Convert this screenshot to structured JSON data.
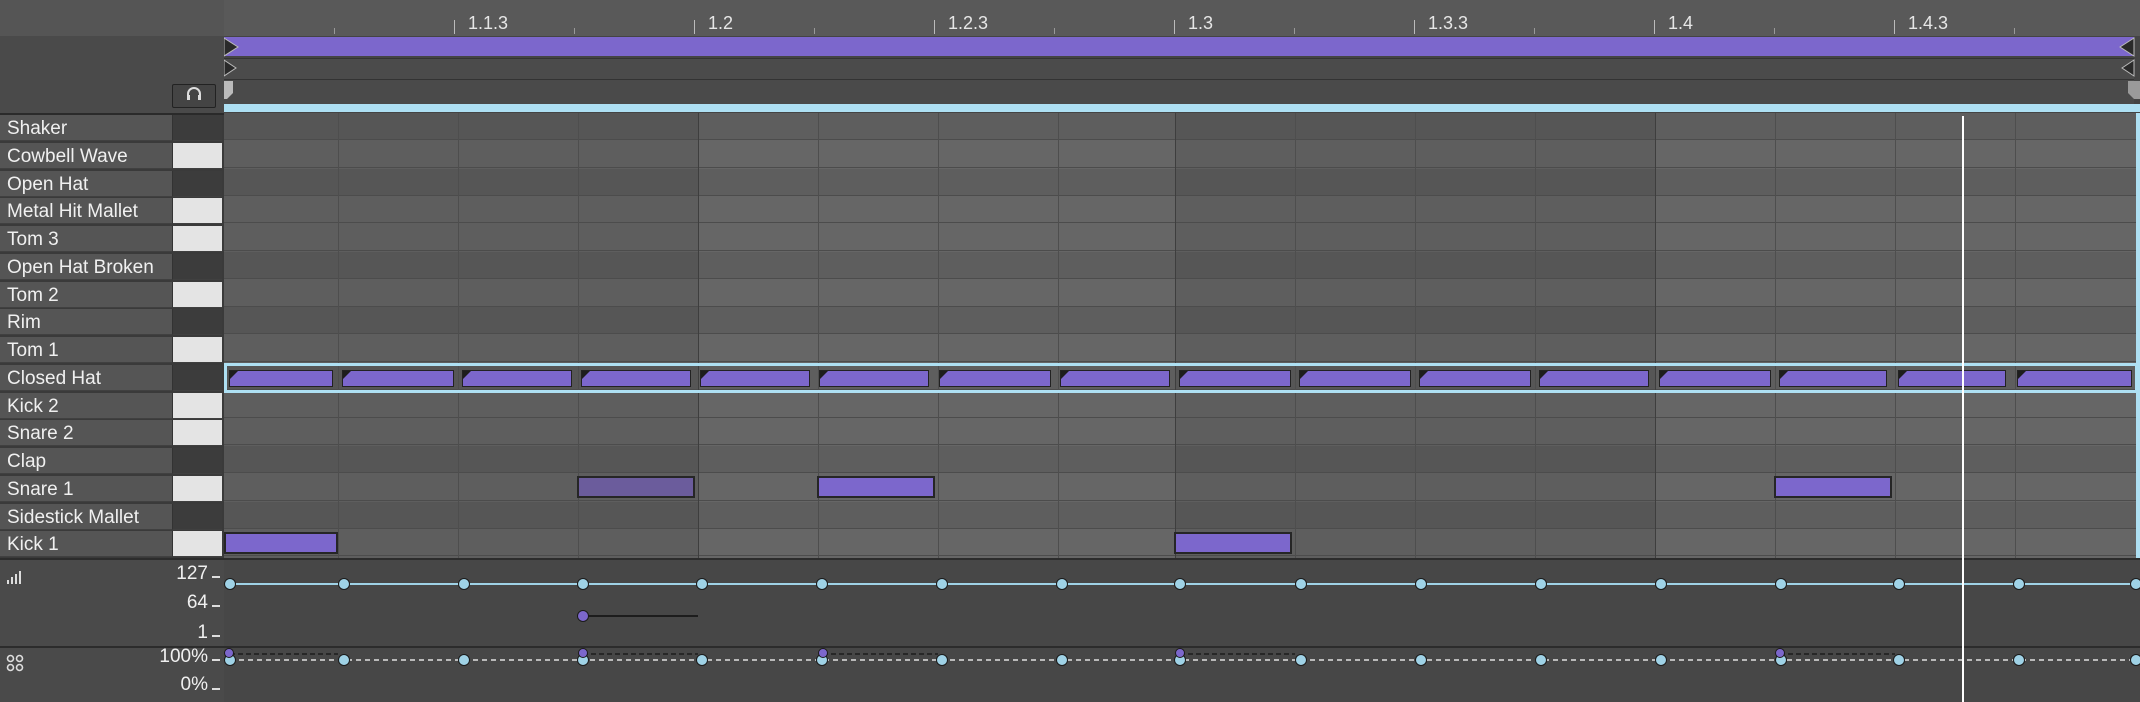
{
  "ruler": {
    "labels": [
      "1.1.3",
      "1.2",
      "1.2.3",
      "1.3",
      "1.3.3",
      "1.4",
      "1.4.3"
    ]
  },
  "tracks": [
    {
      "name": "Shaker",
      "key": "black"
    },
    {
      "name": "Cowbell Wave",
      "key": "white"
    },
    {
      "name": "Open Hat",
      "key": "black"
    },
    {
      "name": "Metal Hit Mallet",
      "key": "white"
    },
    {
      "name": "Tom 3",
      "key": "white"
    },
    {
      "name": "Open Hat Broken",
      "key": "black"
    },
    {
      "name": "Tom 2",
      "key": "white"
    },
    {
      "name": "Rim",
      "key": "black"
    },
    {
      "name": "Tom 1",
      "key": "white"
    },
    {
      "name": "Closed Hat",
      "key": "black"
    },
    {
      "name": "Kick 2",
      "key": "white"
    },
    {
      "name": "Snare 2",
      "key": "white"
    },
    {
      "name": "Clap",
      "key": "black"
    },
    {
      "name": "Snare 1",
      "key": "white"
    },
    {
      "name": "Sidestick Mallet",
      "key": "black"
    },
    {
      "name": "Kick 1",
      "key": "white"
    }
  ],
  "velocity": {
    "max_label": "127",
    "mid_label": "64",
    "min_label": "1"
  },
  "probability": {
    "max_label": "100%",
    "min_label": "0%"
  },
  "colors": {
    "note": "#7c67cc",
    "selection": "#aee0f3",
    "playhead": "#ffffff"
  },
  "icons": {
    "preview": "headphones-icon",
    "velocity": "velocity-bars-icon",
    "probability": "probability-dots-icon"
  }
}
